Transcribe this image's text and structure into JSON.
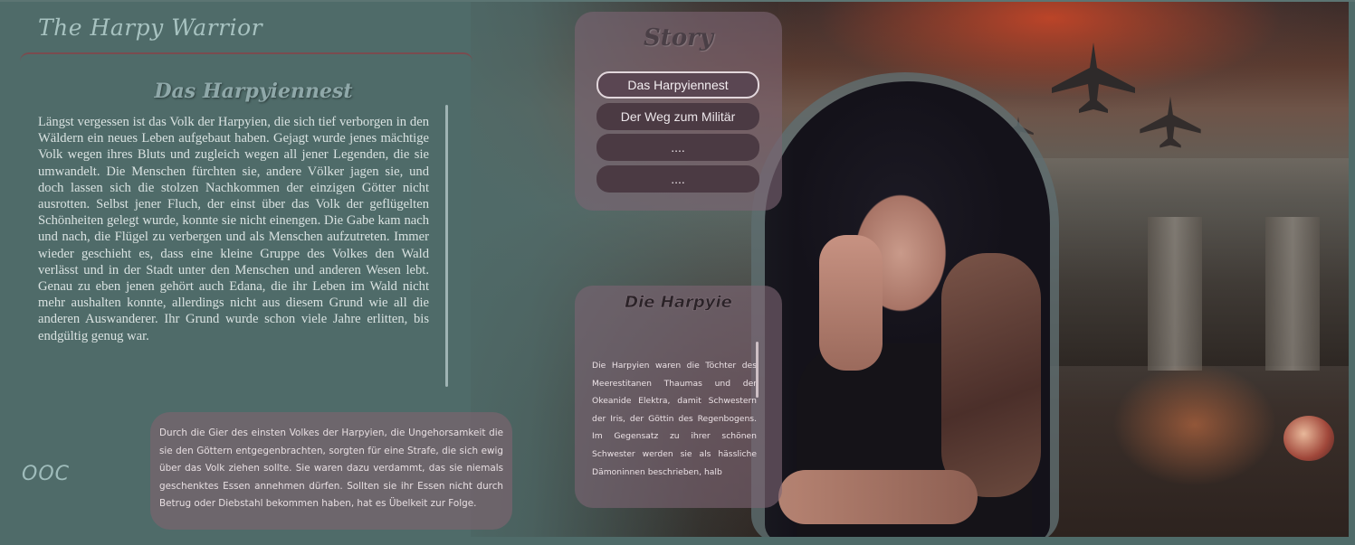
{
  "header": {
    "site_title": "The Harpy Warrior"
  },
  "article": {
    "heading": "Das Harpyiennest",
    "paragraphs": [
      "Längst vergessen ist das Volk der Harpyien, die sich tief verborgen in den Wäldern ein neues Leben aufgebaut haben. Gejagt wurde jenes mächtige Volk wegen ihres Bluts und zugleich wegen all jener Legenden, die sie umwandelt. Die Menschen fürchten sie, andere Völker jagen sie, und doch lassen sich die stolzen Nachkommen der einzigen Götter nicht ausrotten. Selbst jener Fluch, der einst über das Volk der geflügelten Schönheiten gelegt wurde, konnte sie nicht einengen. Die Gabe kam nach und nach, die Flügel zu verbergen und als Menschen aufzutreten. Immer wieder geschieht es, dass eine kleine Gruppe des Volkes den Wald verlässt und in der Stadt unter den Menschen und anderen Wesen lebt. Genau zu eben jenen gehört auch Edana, die ihr Leben im Wald nicht mehr aushalten konnte, allerdings nicht aus diesem Grund wie all die anderen Auswanderer. Ihr Grund wurde schon viele Jahre erlitten, bis endgültig genug war."
    ]
  },
  "ooc": {
    "label": "OOC",
    "text": "Durch die Gier des einsten Volkes der Harpyien, die Ungehorsamkeit die sie den Göttern entgegenbrachten, sorgten für eine Strafe, die sich ewig über das Volk ziehen sollte. Sie waren dazu verdammt, das sie niemals geschenktes Essen annehmen dürfen. Sollten sie ihr Essen nicht durch Betrug oder Diebstahl bekommen haben, hat es Übelkeit zur Folge."
  },
  "story": {
    "title": "Story",
    "items": [
      {
        "label": "Das Harpyiennest"
      },
      {
        "label": "Der Weg zum Militär"
      },
      {
        "label": "...."
      },
      {
        "label": "...."
      }
    ]
  },
  "harpyie": {
    "title": "Die Harpyie",
    "text": "Die Harpyien waren die Töchter des Meerestitanen Thaumas und der Okeanide Elektra, damit Schwestern der Iris, der Göttin des Regenbogens. Im Gegensatz zu ihrer schönen Schwester werden sie als hässliche Dämoninnen beschrieben, halb"
  }
}
